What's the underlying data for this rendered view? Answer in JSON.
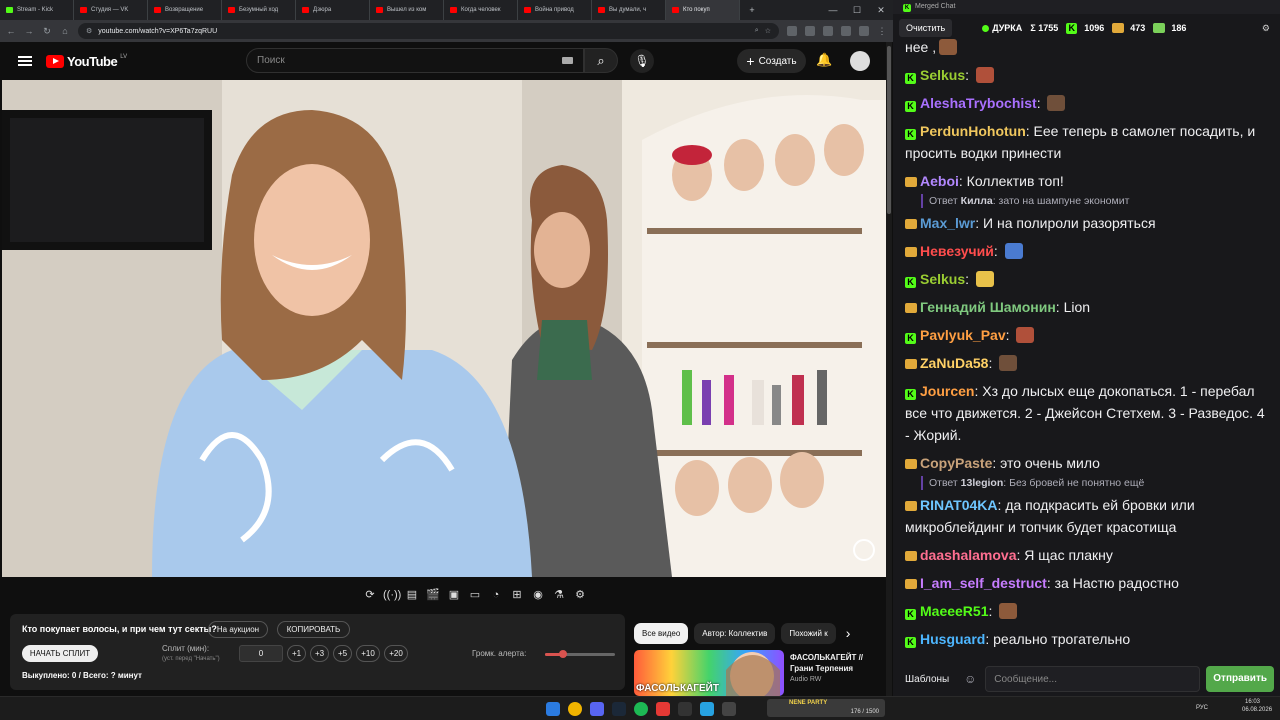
{
  "browser": {
    "tabs": [
      {
        "label": "Stream - Kick",
        "favicon": "kick"
      },
      {
        "label": "Студия — VK",
        "favicon": "youtube"
      },
      {
        "label": "Возвращение",
        "favicon": "youtube"
      },
      {
        "label": "Безумный ход",
        "favicon": "youtube"
      },
      {
        "label": "Дзюра",
        "favicon": "youtube"
      },
      {
        "label": "Вышел из ком",
        "favicon": "youtube"
      },
      {
        "label": "Когда человек",
        "favicon": "youtube"
      },
      {
        "label": "Война привод",
        "favicon": "youtube"
      },
      {
        "label": "Вы думали, ч",
        "favicon": "youtube"
      },
      {
        "label": "Кто покуп",
        "favicon": "youtube",
        "active": true
      }
    ],
    "new_tab": "+",
    "url": "youtube.com/watch?v=XP6Ta7zqRUU"
  },
  "youtube": {
    "logo_text": "YouTube",
    "country": "LV",
    "search_placeholder": "Поиск",
    "create_label": "Создать",
    "create_plus": "+"
  },
  "tool_panel": {
    "question": "Кто покупает волосы, и при чем тут секты?",
    "auction_btn": "На аукцион",
    "copy_btn": "КОПИРОВАТЬ",
    "start_split_btn": "НАЧАТЬ СПЛИТ",
    "split_label": "Сплит (мин):",
    "split_hint": "(уст. перед \"Начать\")",
    "split_value": "0",
    "inc_buttons": [
      "+1",
      "+3",
      "+5",
      "+10",
      "+20"
    ],
    "alert_volume_label": "Громк. алерта:",
    "alert_volume_fraction": 0.25,
    "bought_text": "Выкуплено: 0 / Всего: ? минут"
  },
  "recommendations": {
    "chips": [
      "Все видео",
      "Автор: Коллектив",
      "Похожий к"
    ],
    "next_arrow": "›",
    "item": {
      "thumb_text": "ФАСОЛЬКАГЕЙТ",
      "title": "ФАСОЛЬКАГЕЙТ // Грани Терпения",
      "channel": "Audio RW"
    }
  },
  "chat": {
    "window_title": "Merged Chat",
    "clear_btn": "Очистить",
    "streamer": "ДУРКА",
    "stats": [
      {
        "icon": "sigma",
        "value": "Σ 1755"
      },
      {
        "icon": "kick",
        "value": "1096"
      },
      {
        "icon": "other",
        "value": "473"
      },
      {
        "icon": "other2",
        "value": "186"
      }
    ],
    "colors": {
      "kick_green": "#53fc18",
      "send_green": "#53a84a"
    },
    "messages": [
      {
        "user": "",
        "color": "#efeff1",
        "badge": "",
        "text": "нее ,",
        "emote": true
      },
      {
        "user": "Selkus",
        "color": "#9acd32",
        "badge": "kick",
        "text": "",
        "emote": true
      },
      {
        "user": "AleshaTrybochist",
        "color": "#a970ff",
        "badge": "kick",
        "text": "",
        "emote": true
      },
      {
        "user": "PerdunHohotun",
        "color": "#f0c75e",
        "badge": "kick",
        "text": "Еее теперь в самолет посадить, и просить водки принести"
      },
      {
        "user": "Aeboi",
        "color": "#b388ff",
        "badge": "other",
        "text": "Коллектив топ!",
        "reply_user": "Килла",
        "reply_text": "зато на шампуне экономит"
      },
      {
        "user": "Max_lwr",
        "color": "#5b9bd5",
        "badge": "other",
        "text": "И на полироли разоряться"
      },
      {
        "user": "Невезучий",
        "color": "#ff4d4d",
        "badge": "other",
        "text": "",
        "emote": true
      },
      {
        "user": "Selkus",
        "color": "#9acd32",
        "badge": "kick",
        "text": "",
        "emote": true
      },
      {
        "user": "Геннадий Шамонин",
        "color": "#7fc97f",
        "badge": "other",
        "text": "Lion"
      },
      {
        "user": "Pavlyuk_Pav",
        "color": "#ff9f43",
        "badge": "kick",
        "text": "",
        "emote": true
      },
      {
        "user": "ZaNuDa58",
        "color": "#ffd166",
        "badge": "other",
        "text": "",
        "emote": true
      },
      {
        "user": "Jourcen",
        "color": "#ff9f43",
        "badge": "kick",
        "text": "Хз до лысых еще докопаться. 1 - перебал все что движется. 2 - Джейсон Стетхем. 3 - Разведос. 4 - Жорий."
      },
      {
        "user": "CopyPaste",
        "color": "#c8a27a",
        "badge": "other",
        "text": "это очень мило",
        "reply_user": "13legion",
        "reply_text": "Без бровей не понятно ещё"
      },
      {
        "user": "RINAT04KA",
        "color": "#6ec6ff",
        "badge": "other",
        "text": "да подкрасить ей бровки или микроблейдинг и топчик будет красотища"
      },
      {
        "user": "daashalamova",
        "color": "#ff6f91",
        "badge": "other",
        "text": "Я щас плакну"
      },
      {
        "user": "I_am_self_destruct",
        "color": "#c77dff",
        "badge": "other",
        "text": "за Настю радостно"
      },
      {
        "user": "MaeeeR51",
        "color": "#53fc18",
        "badge": "kick",
        "text": "",
        "emote": true
      },
      {
        "user": "Husguard",
        "color": "#4db6ff",
        "badge": "kick",
        "text": "реально трогательно"
      }
    ],
    "templates_btn": "Шаблоны",
    "input_placeholder": "Сообщение...",
    "send_btn": "Отправить"
  },
  "taskbar": {
    "game_label": "NENE PARTY",
    "game_counter": "176 / 1500",
    "lang": "РУС",
    "time": "16:03",
    "date": "06.08.2026"
  }
}
